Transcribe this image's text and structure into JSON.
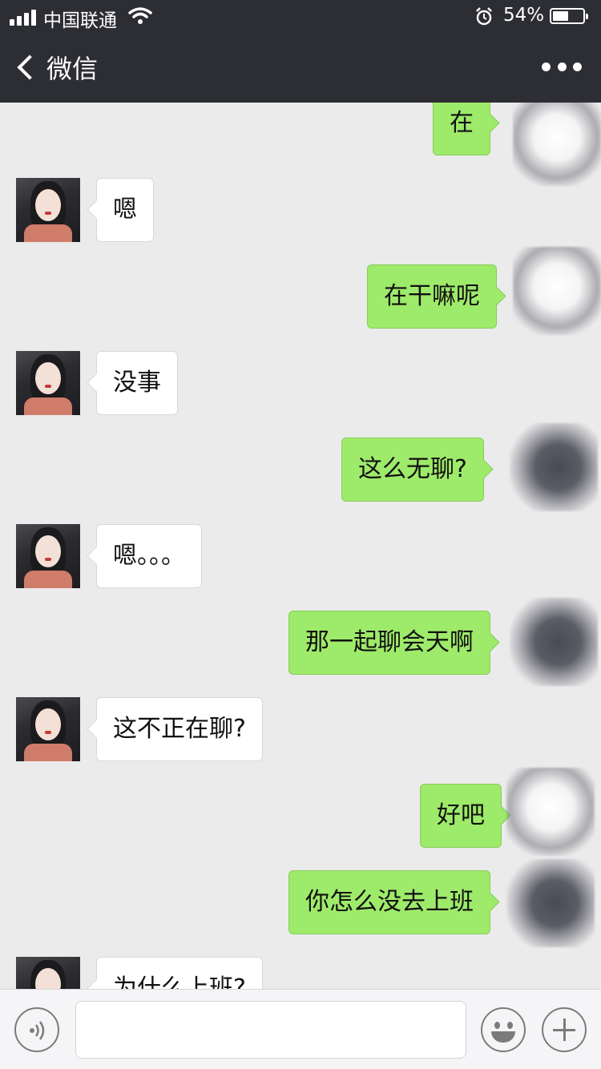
{
  "status_bar": {
    "carrier": "中国联通",
    "alarm_icon": "alarm-icon",
    "battery_percent": "54%",
    "battery_level": 0.54
  },
  "nav": {
    "back_label": "微信",
    "back_icon": "chevron-left-icon",
    "more_icon": "more-dots-icon"
  },
  "messages": [
    {
      "side": "out",
      "text": "在"
    },
    {
      "side": "in",
      "text": "嗯"
    },
    {
      "side": "out",
      "text": "在干嘛呢"
    },
    {
      "side": "in",
      "text": "没事"
    },
    {
      "side": "out",
      "text": "这么无聊?"
    },
    {
      "side": "in",
      "text": "嗯。。。"
    },
    {
      "side": "out",
      "text": "那一起聊会天啊"
    },
    {
      "side": "in",
      "text": "这不正在聊?"
    },
    {
      "side": "out",
      "text": "好吧"
    },
    {
      "side": "out",
      "text": "你怎么没去上班"
    },
    {
      "side": "in",
      "text": "为什么上班?"
    }
  ],
  "input_bar": {
    "voice_icon": "voice-icon",
    "text_value": "",
    "emoji_icon": "emoji-icon",
    "plus_icon": "plus-icon"
  },
  "colors": {
    "nav_bg": "#2d2e33",
    "chat_bg": "#ebebeb",
    "outgoing_bubble": "#9eea6a",
    "incoming_bubble": "#ffffff"
  }
}
